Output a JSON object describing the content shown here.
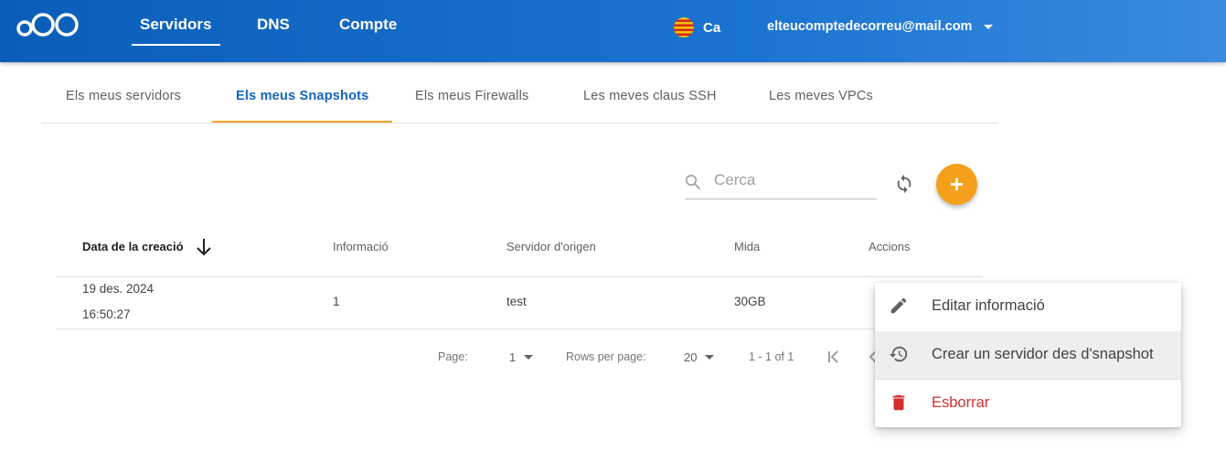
{
  "header": {
    "nav": [
      "Servidors",
      "DNS",
      "Compte"
    ],
    "language": "Ca",
    "account_email": "elteucomptedecorreu@mail.com"
  },
  "tabs": [
    "Els meus servidors",
    "Els meus Snapshots",
    "Els meus Firewalls",
    "Les meves claus SSH",
    "Les meves VPCs"
  ],
  "active_tab": "Els meus Snapshots",
  "search": {
    "placeholder": "Cerca"
  },
  "table": {
    "columns": [
      "Data de la creació",
      "Informació",
      "Servidor d'origen",
      "Mida",
      "Accions"
    ],
    "sorted_column": "Data de la creació",
    "rows": [
      {
        "date": "19 des. 2024",
        "time": "16:50:27",
        "info": "1",
        "origin": "test",
        "size": "30GB"
      }
    ]
  },
  "pagination": {
    "page_label": "Page:",
    "page": "1",
    "rows_label": "Rows per page:",
    "rows_per_page": "20",
    "range": "1 - 1 of 1"
  },
  "context_menu": {
    "items": [
      {
        "label": "Editar informació",
        "icon": "pencil-icon"
      },
      {
        "label": "Crear un servidor des d'snapshot",
        "icon": "restore-history-icon"
      },
      {
        "label": "Esborrar",
        "icon": "trash-icon"
      }
    ]
  },
  "colors": {
    "header_blue": "#1565c0",
    "accent_orange": "#f5a01a",
    "active_tab_blue": "#1565c0",
    "danger_red": "#d32f2f"
  }
}
